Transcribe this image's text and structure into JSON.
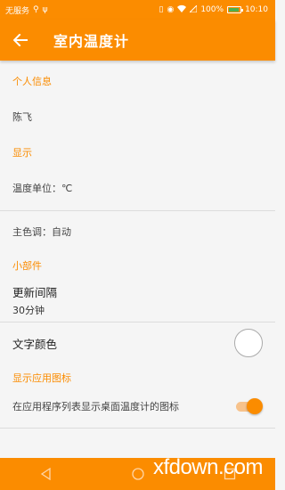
{
  "status_bar": {
    "carrier": "无服务",
    "battery_percent": "100%",
    "time": "10:10",
    "icons": [
      "usb-icon",
      "vibrate-icon",
      "eye-icon",
      "wifi-icon",
      "alarm-icon",
      "battery-icon"
    ]
  },
  "app_bar": {
    "title": "室内温度计",
    "back_icon": "arrow-left-icon"
  },
  "sections": {
    "personal": {
      "header": "个人信息",
      "name": "陈飞"
    },
    "display": {
      "header": "显示",
      "temperature_unit": "温度单位：℃",
      "theme_color": "主色调：自动"
    },
    "widget": {
      "header": "小部件",
      "update_interval_title": "更新间隔",
      "update_interval_value": "30分钟",
      "text_color_title": "文字颜色"
    },
    "app_icon": {
      "header": "显示应用图标",
      "show_icon_label": "在应用程序列表显示桌面温度计的图标",
      "show_icon_enabled": true
    }
  },
  "watermark": "xfdown.com",
  "colors": {
    "accent": "#fb8c00",
    "toggle_track": "#f7c28b"
  }
}
